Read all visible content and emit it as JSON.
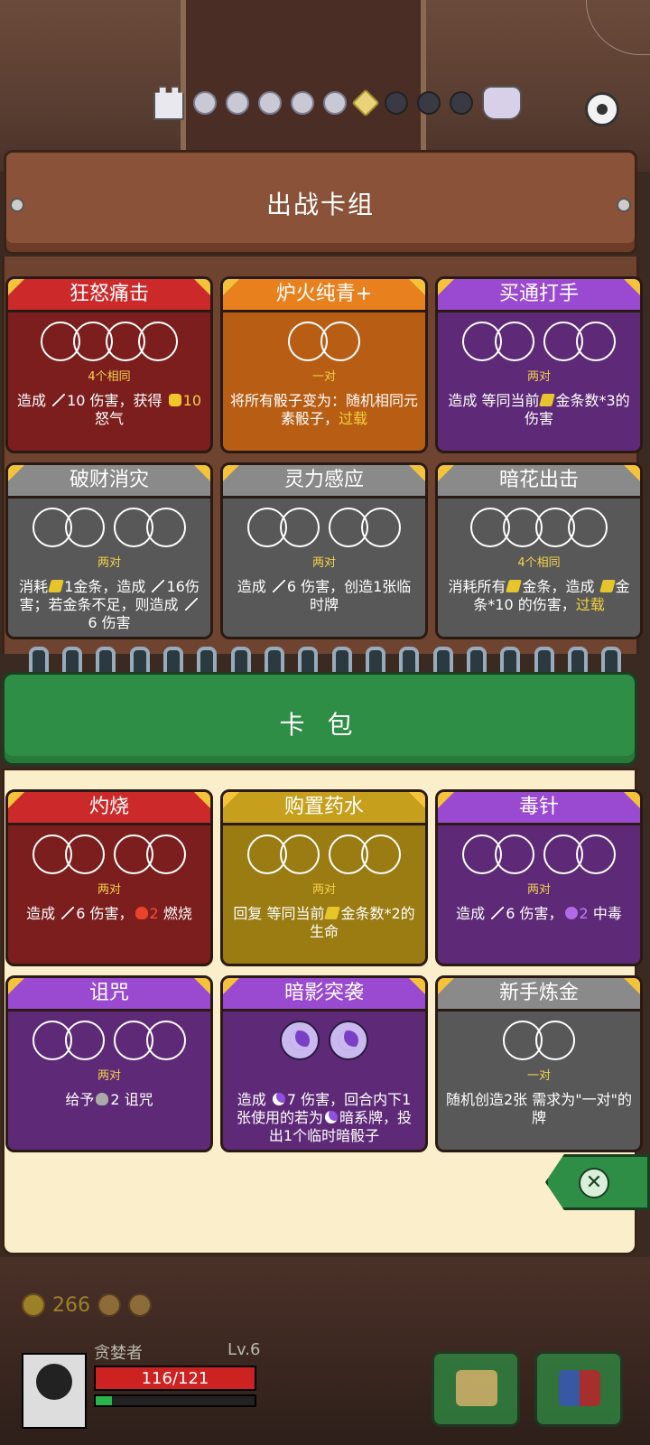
{
  "deck": {
    "title": "出战卡组",
    "cards": [
      {
        "name": "狂怒痛击",
        "color": "red",
        "req": "4个相同",
        "dice_groups": [
          4
        ],
        "desc": [
          {
            "t": "造成 "
          },
          {
            "i": "sword"
          },
          {
            "t": "10 伤害，获得 "
          },
          {
            "i": "fist"
          },
          {
            "t": "10",
            "hl": true
          },
          {
            "t": " 怒气"
          }
        ]
      },
      {
        "name": "炉火纯青+",
        "color": "orange",
        "req": "一对",
        "dice_groups": [
          2
        ],
        "desc": [
          {
            "t": "将所有骰子变为：随机相同元素骰子，"
          },
          {
            "t": "过载",
            "hl": true
          }
        ]
      },
      {
        "name": "买通打手",
        "color": "purple",
        "req": "两对",
        "dice_groups": [
          2,
          2
        ],
        "desc": [
          {
            "t": "造成 等同当前"
          },
          {
            "i": "gold"
          },
          {
            "t": "金条数*3的伤害"
          }
        ]
      },
      {
        "name": "破财消灾",
        "color": "gray",
        "req": "两对",
        "dice_groups": [
          2,
          2
        ],
        "desc": [
          {
            "t": "消耗"
          },
          {
            "i": "gold"
          },
          {
            "t": "1金条，造成 "
          },
          {
            "i": "sword"
          },
          {
            "t": "16伤害；若金条不足，则造成 "
          },
          {
            "i": "sword"
          },
          {
            "t": "6 伤害"
          }
        ]
      },
      {
        "name": "灵力感应",
        "color": "gray",
        "req": "两对",
        "dice_groups": [
          2,
          2
        ],
        "desc": [
          {
            "t": "造成 "
          },
          {
            "i": "sword"
          },
          {
            "t": "6 伤害，创造1张临时牌"
          }
        ]
      },
      {
        "name": "暗花出击",
        "color": "gray",
        "req": "4个相同",
        "dice_groups": [
          4
        ],
        "desc": [
          {
            "t": "消耗所有"
          },
          {
            "i": "gold"
          },
          {
            "t": "金条，造成 "
          },
          {
            "i": "gold"
          },
          {
            "t": "金条*10 的伤害，"
          },
          {
            "t": "过载",
            "hl": true
          }
        ]
      }
    ]
  },
  "pack": {
    "title": "卡 包",
    "cards": [
      {
        "name": "灼烧",
        "color": "red",
        "req": "两对",
        "dice_groups": [
          2,
          2
        ],
        "desc": [
          {
            "t": "造成 "
          },
          {
            "i": "sword"
          },
          {
            "t": "6 伤害，"
          },
          {
            "i": "fire"
          },
          {
            "t": "2",
            "red": true
          },
          {
            "t": " 燃烧"
          }
        ]
      },
      {
        "name": "购置药水",
        "color": "olive",
        "req": "两对",
        "dice_groups": [
          2,
          2
        ],
        "desc": [
          {
            "t": "回复 等同当前"
          },
          {
            "i": "gold"
          },
          {
            "t": "金条数*2的生命"
          }
        ]
      },
      {
        "name": "毒针",
        "color": "purple",
        "req": "两对",
        "dice_groups": [
          2,
          2
        ],
        "desc": [
          {
            "t": "造成 "
          },
          {
            "i": "sword"
          },
          {
            "t": "6 伤害，"
          },
          {
            "i": "poison"
          },
          {
            "t": "2",
            "purple": true
          },
          {
            "t": " 中毒"
          }
        ]
      },
      {
        "name": "诅咒",
        "color": "purple",
        "req": "两对",
        "dice_groups": [
          2,
          2
        ],
        "desc": [
          {
            "t": "给予"
          },
          {
            "i": "skull"
          },
          {
            "t": "2 诅咒"
          }
        ]
      },
      {
        "name": "暗影突袭",
        "color": "purple",
        "req": "",
        "dice_groups": [
          1,
          1
        ],
        "dark": true,
        "desc": [
          {
            "t": "造成 "
          },
          {
            "i": "moon"
          },
          {
            "t": "7 伤害，回合内下1张使用的若为"
          },
          {
            "i": "moon"
          },
          {
            "t": "暗系牌，投出1个临时暗骰子"
          }
        ]
      },
      {
        "name": "新手炼金",
        "color": "gray",
        "req": "一对",
        "dice_groups": [
          2
        ],
        "desc": [
          {
            "t": "随机创造2张 需求为\"一对\"的牌"
          }
        ]
      }
    ]
  },
  "player": {
    "gold": "266",
    "name": "贪婪者",
    "level": "Lv.6",
    "hp": "116/121",
    "xp_fraction": 0.1
  },
  "map": {
    "nodes": [
      "tower",
      "done",
      "done",
      "done",
      "done",
      "done",
      "current",
      "future",
      "future",
      "future",
      "boss"
    ]
  },
  "colors": {
    "red": "#cc2a2a",
    "orange": "#e8801e",
    "purple": "#9a4ad0",
    "gray": "#8a8a8a",
    "olive": "#c6a01c",
    "green": "#2f8e45"
  }
}
